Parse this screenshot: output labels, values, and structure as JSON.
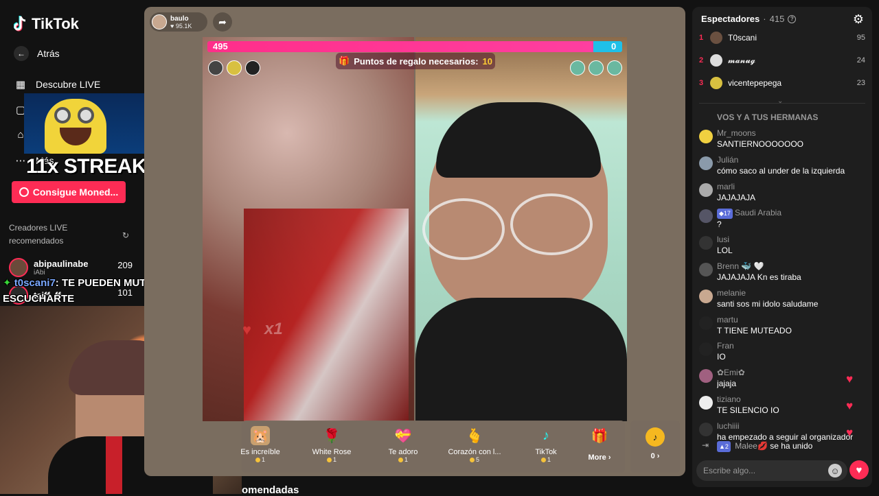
{
  "sidebar": {
    "logo": "TikTok",
    "back_label": "Atrás",
    "nav": [
      {
        "label": "Descubre LIVE",
        "icon": "calendar-icon"
      },
      {
        "label": "",
        "icon": "square-icon"
      },
      {
        "label": "",
        "icon": "home-icon"
      },
      {
        "label": "Más",
        "icon": "more-icon"
      }
    ],
    "coins_button": "Consigue Moned...",
    "creators_title": "Creadores LIVE recomendados",
    "creators": [
      {
        "name": "abipaulinabe",
        "sub": "iAbi",
        "count": "209"
      },
      {
        "name": "taiff_ff",
        "sub": "",
        "count": "101"
      }
    ]
  },
  "overlay": {
    "streak": "11x STREAK",
    "chat_user": "t0scani7",
    "chat_line1": ": TE PUEDEN MUTEAR PARA NO",
    "chat_line2": "ESCUCHARTE"
  },
  "live": {
    "host_name": "baulo",
    "host_likes": "95.1K",
    "score_left": "495",
    "score_right": "0",
    "score_left_fraction": 0.93,
    "gift_banner_label": "Puntos de regalo necesarios:",
    "gift_banner_value": "10",
    "combo": "x1",
    "gifts": [
      {
        "name": "Es increíble",
        "cost": "1",
        "icon": "hamster-icon"
      },
      {
        "name": "White Rose",
        "cost": "1",
        "icon": "rose-icon"
      },
      {
        "name": "Te adoro",
        "cost": "1",
        "icon": "heart-gift-icon"
      },
      {
        "name": "Corazón con l...",
        "cost": "5",
        "icon": "finger-heart-icon"
      },
      {
        "name": "TikTok",
        "cost": "1",
        "icon": "tiktok-icon"
      }
    ],
    "more_label": "More",
    "coin_balance": "0",
    "bottom_heading": "omendadas"
  },
  "chat": {
    "title": "Espectadores",
    "viewer_count": "415",
    "ranking": [
      {
        "rank": "1",
        "name": "T0scani",
        "value": "95",
        "color": "#6a5040"
      },
      {
        "rank": "2",
        "name": "𝓶𝓪𝓷𝓾𝓰",
        "value": "24",
        "color": "#ddd"
      },
      {
        "rank": "3",
        "name": "vicentepepega",
        "value": "23",
        "color": "#d8c040"
      }
    ],
    "pinned": "VOS Y A TUS HERMANAS",
    "messages": [
      {
        "user": "Mr_moons",
        "text": "SANTIERNOOOOOOO",
        "color": "#f0d040",
        "badge": "",
        "heart": false
      },
      {
        "user": "Julián",
        "text": "cómo saco al under de la izquierda",
        "color": "#8a9aaa",
        "badge": "",
        "heart": false
      },
      {
        "user": "marli",
        "text": "JAJAJAJA",
        "color": "#aaa",
        "badge": "",
        "heart": false
      },
      {
        "user": "Saudi Arabia",
        "text": "?",
        "color": "#556",
        "badge": "17",
        "heart": false
      },
      {
        "user": "lusi",
        "text": "LOL",
        "color": "#333",
        "badge": "",
        "heart": false
      },
      {
        "user": "Brenn 🐳 🤍",
        "text": "JAJAJAJA Kn es tiraba",
        "color": "#555",
        "badge": "",
        "heart": false
      },
      {
        "user": "melanie",
        "text": "santi sos mi idolo saludame",
        "color": "#c8a890",
        "badge": "",
        "heart": false
      },
      {
        "user": "martu",
        "text": "T TIENE MUTEADO",
        "color": "#222",
        "badge": "",
        "heart": false
      },
      {
        "user": "Fran",
        "text": "IO",
        "color": "#222",
        "badge": "",
        "heart": false
      },
      {
        "user": "✿Emi✿",
        "text": "jajaja",
        "color": "#a06080",
        "badge": "",
        "heart": true
      },
      {
        "user": "tiziano",
        "text": "TE SILENCIO IO",
        "color": "#eee",
        "badge": "",
        "heart": true
      },
      {
        "user": "luchiiii",
        "text": "ha empezado a seguir al organizador",
        "color": "#333",
        "badge": "",
        "heart": true
      }
    ],
    "join_badge": "2",
    "join_user": "Malee💋",
    "join_text": "se ha unido",
    "input_placeholder": "Escribe algo..."
  }
}
